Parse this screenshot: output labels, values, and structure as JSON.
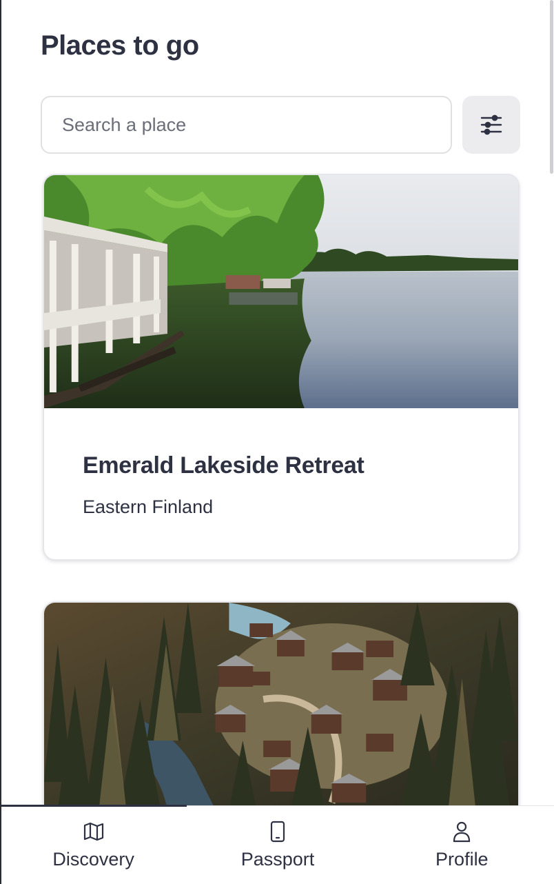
{
  "header": {
    "title": "Places to go"
  },
  "search": {
    "placeholder": "Search a place",
    "value": ""
  },
  "filter": {
    "icon": "sliders-icon"
  },
  "places": [
    {
      "name": "Emerald Lakeside Retreat",
      "region": "Eastern Finland",
      "image": "lakeside-boathouse-photo"
    },
    {
      "name": "",
      "region": "",
      "image": "forest-village-aerial-photo"
    }
  ],
  "bottom_nav": {
    "active": "Discovery",
    "tabs": [
      {
        "label": "Discovery",
        "icon": "map-icon"
      },
      {
        "label": "Passport",
        "icon": "phone-icon"
      },
      {
        "label": "Profile",
        "icon": "person-icon"
      }
    ]
  },
  "colors": {
    "text": "#2d3142",
    "muted": "#6b6e78",
    "border": "#e0e0e4",
    "button_bg": "#ececef"
  }
}
